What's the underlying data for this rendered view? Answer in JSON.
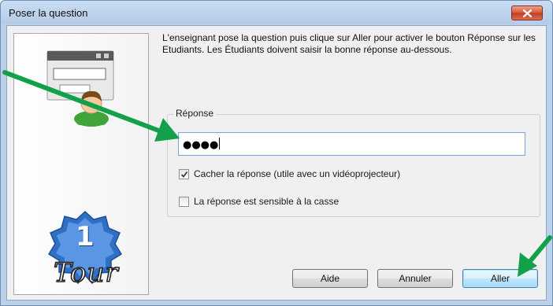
{
  "window": {
    "title": "Poser la question"
  },
  "description": "L'enseignant pose la question puis clique sur Aller pour activer le bouton Réponse sur les Etudiants. Les Étudiants doivent saisir la bonne réponse au-dessous.",
  "answer_group": {
    "label": "Réponse",
    "value": "●●●●",
    "hide_answer": {
      "label": "Cacher la réponse (utile avec un vidéoprojecteur)",
      "checked": true
    },
    "case_sensitive": {
      "label": "La réponse est sensible à la casse",
      "checked": false
    }
  },
  "badge": {
    "number": "1",
    "word": "Tour"
  },
  "buttons": {
    "help": "Aide",
    "cancel": "Annuler",
    "go": "Aller"
  },
  "colors": {
    "annotation_arrow": "#13a04a",
    "badge_blue": "#2f6fc4",
    "user_green": "#3fa43a"
  }
}
